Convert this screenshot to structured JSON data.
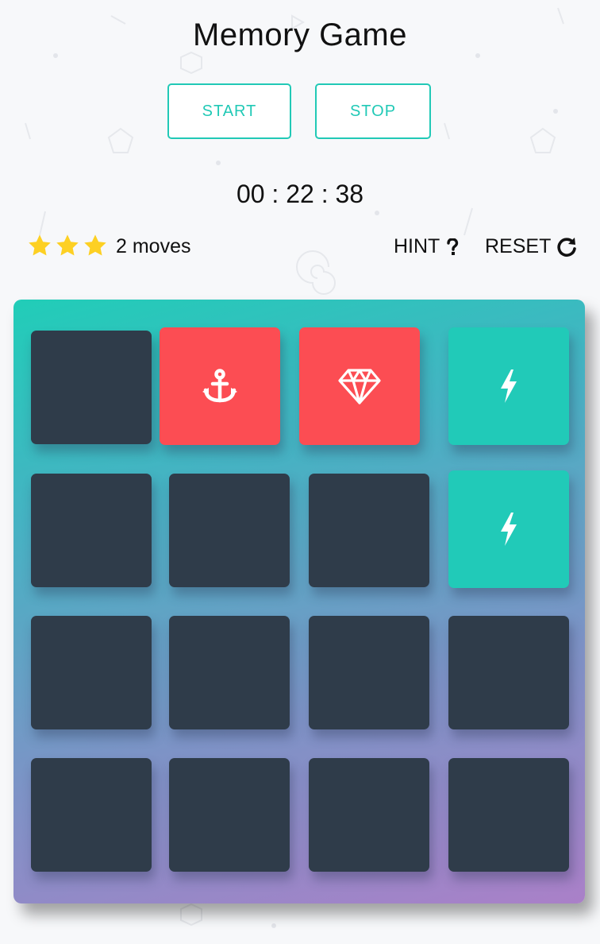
{
  "header": {
    "title": "Memory Game"
  },
  "controls": {
    "start_label": "START",
    "stop_label": "STOP"
  },
  "timer": {
    "display": "00 : 22 : 38"
  },
  "score": {
    "stars_filled": 3,
    "stars_total": 3,
    "moves_text": "2 moves"
  },
  "actions": {
    "hint_label": "HINT",
    "reset_label": "RESET"
  },
  "colors": {
    "accent": "#21c9b6",
    "card_back": "#2f3c4a",
    "card_open": "#fc4d53",
    "card_match": "#21cab8",
    "star": "#fdd023"
  },
  "board": {
    "rows": 4,
    "cols": 4,
    "cards": [
      {
        "state": "closed",
        "icon": ""
      },
      {
        "state": "open",
        "icon": "anchor-icon"
      },
      {
        "state": "open",
        "icon": "diamond-icon"
      },
      {
        "state": "match",
        "icon": "bolt-icon"
      },
      {
        "state": "closed",
        "icon": ""
      },
      {
        "state": "closed",
        "icon": ""
      },
      {
        "state": "closed",
        "icon": ""
      },
      {
        "state": "match",
        "icon": "bolt-icon"
      },
      {
        "state": "closed",
        "icon": ""
      },
      {
        "state": "closed",
        "icon": ""
      },
      {
        "state": "closed",
        "icon": ""
      },
      {
        "state": "closed",
        "icon": ""
      },
      {
        "state": "closed",
        "icon": ""
      },
      {
        "state": "closed",
        "icon": ""
      },
      {
        "state": "closed",
        "icon": ""
      },
      {
        "state": "closed",
        "icon": ""
      }
    ]
  }
}
